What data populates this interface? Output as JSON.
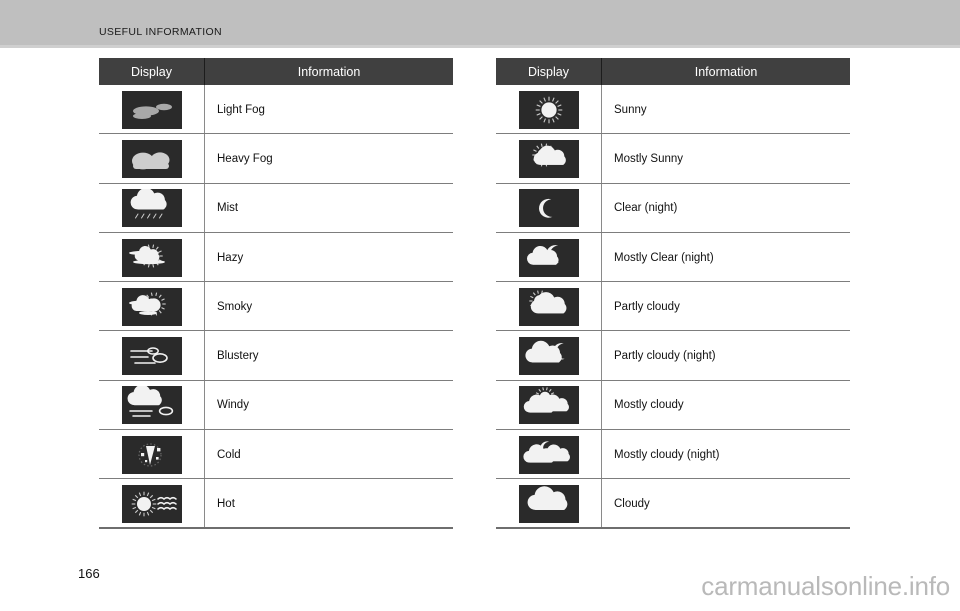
{
  "header": {
    "title": "USEFUL INFORMATION"
  },
  "footer": {
    "page_number": "166",
    "watermark": "carmanualsonline.info"
  },
  "colors": {
    "header_band": "#bfbfbf",
    "table_header_bg": "#404040",
    "table_header_text": "#ffffff",
    "icon_tile_bg": "#2a2a2a",
    "rule": "#7d7d7d",
    "body_text": "#111111",
    "watermark": "#b9b9b9"
  },
  "tables": [
    {
      "id": "left",
      "columns": [
        "Display",
        "Information"
      ],
      "rows": [
        {
          "icon": "light-fog-icon",
          "information": "Light Fog"
        },
        {
          "icon": "heavy-fog-icon",
          "information": "Heavy Fog"
        },
        {
          "icon": "mist-icon",
          "information": "Mist"
        },
        {
          "icon": "hazy-icon",
          "information": "Hazy"
        },
        {
          "icon": "smoky-icon",
          "information": "Smoky"
        },
        {
          "icon": "blustery-icon",
          "information": "Blustery"
        },
        {
          "icon": "windy-icon",
          "information": "Windy"
        },
        {
          "icon": "cold-icon",
          "information": "Cold"
        },
        {
          "icon": "hot-icon",
          "information": "Hot"
        }
      ]
    },
    {
      "id": "right",
      "columns": [
        "Display",
        "Information"
      ],
      "rows": [
        {
          "icon": "sunny-icon",
          "information": "Sunny"
        },
        {
          "icon": "mostly-sunny-icon",
          "information": "Mostly Sunny"
        },
        {
          "icon": "clear-night-icon",
          "information": "Clear (night)"
        },
        {
          "icon": "mostly-clear-night-icon",
          "information": "Mostly Clear (night)"
        },
        {
          "icon": "partly-cloudy-icon",
          "information": "Partly cloudy"
        },
        {
          "icon": "partly-cloudy-night-icon",
          "information": "Partly cloudy (night)"
        },
        {
          "icon": "mostly-cloudy-icon",
          "information": "Mostly cloudy"
        },
        {
          "icon": "mostly-cloudy-night-icon",
          "information": "Mostly cloudy (night)"
        },
        {
          "icon": "cloudy-icon",
          "information": "Cloudy"
        }
      ]
    }
  ]
}
